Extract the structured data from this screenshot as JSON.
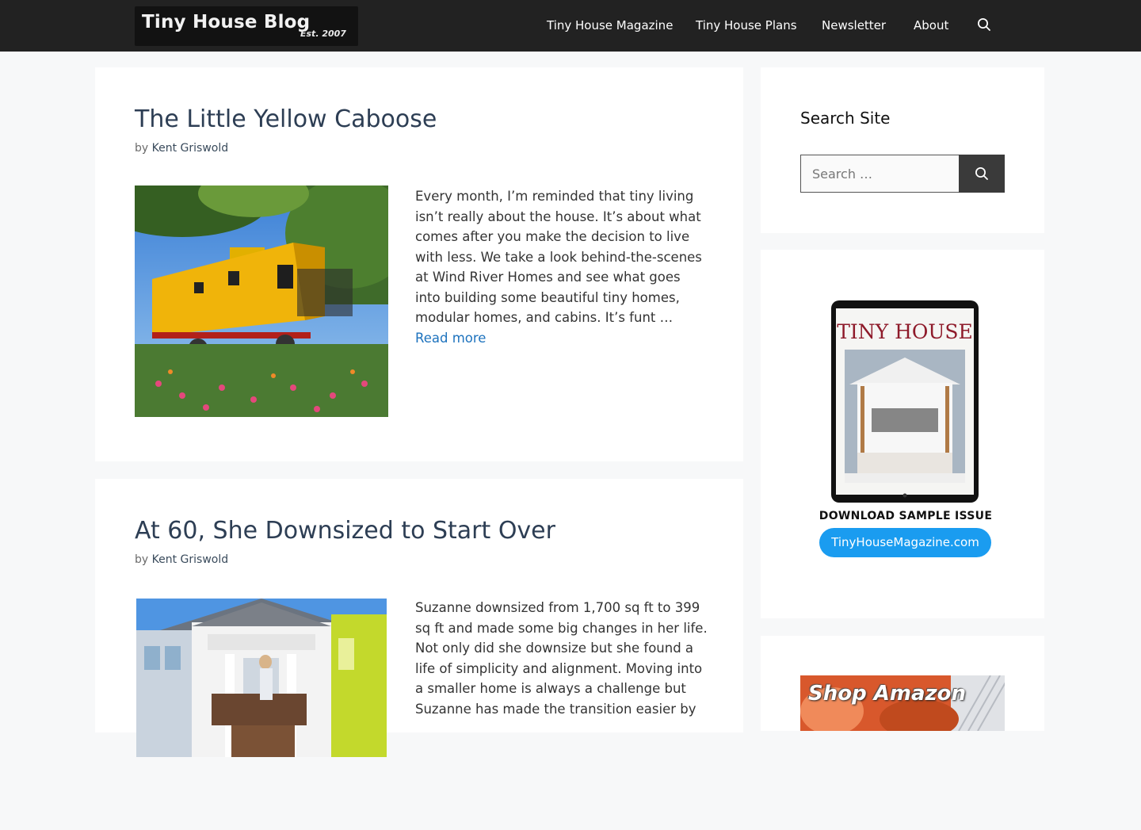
{
  "header": {
    "logo_title": "Tiny House Blog",
    "logo_est": "Est. 2007",
    "nav": [
      "Tiny House Magazine",
      "Tiny House Plans",
      "Newsletter",
      "About"
    ],
    "search_icon": "search-icon"
  },
  "posts": [
    {
      "title": "The Little Yellow Caboose",
      "by": "by",
      "author": "Kent Griswold",
      "excerpt": "Every month, I’m reminded that tiny living isn’t really about the house. It’s about what comes after you make the decision to live with less. We take a look behind-the-scenes at Wind River Homes and see what goes into building some beautiful tiny homes, modular homes, and cabins. It’s funt … ",
      "read_more": "Read more"
    },
    {
      "title": "At 60, She Downsized to Start Over",
      "by": "by",
      "author": "Kent Griswold",
      "excerpt": "Suzanne downsized from 1,700 sq ft to 399 sq ft and made some big changes in her life. Not only did she downsize but she found a life of simplicity and alignment. Moving into a smaller home is always a challenge but Suzanne has made the transition easier by"
    }
  ],
  "sidebar": {
    "search": {
      "title": "Search Site",
      "placeholder": "Search …",
      "button_icon": "search-icon"
    },
    "magazine_ad": {
      "cover_title": "TINY HOUSE",
      "cta": "DOWNLOAD SAMPLE ISSUE",
      "url": "TinyHouseMagazine.com"
    },
    "amazon": {
      "text": "Shop Amazon"
    }
  },
  "colors": {
    "header_bg": "#222222",
    "title": "#2d3e54",
    "link": "#1e73be",
    "mag_button": "#1a9cf0"
  }
}
